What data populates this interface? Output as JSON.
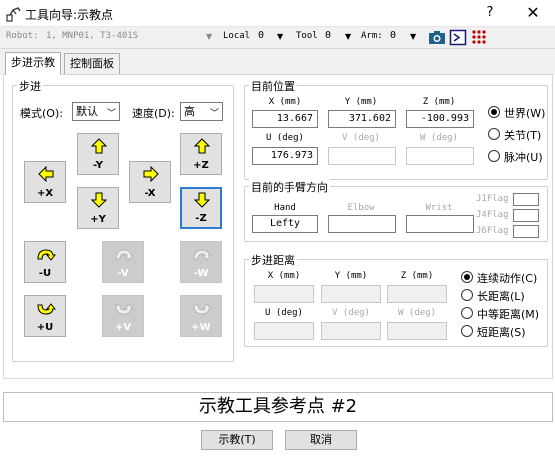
{
  "window": {
    "title": "工具向导:示教点",
    "help_label": "?",
    "close_label": "✕"
  },
  "toolbar": {
    "robot_label": "Robot:",
    "robot_value": "1, MNP01, T3-401S",
    "local_label": "Local",
    "local_value": "0",
    "tool_label": "Tool",
    "tool_value": "0",
    "arm_label": "Arm:",
    "arm_value": "0",
    "icons": [
      "camera-icon",
      "terminal-icon",
      "io-grid-icon"
    ]
  },
  "tabs": [
    {
      "label": "步进示教",
      "active": true
    },
    {
      "label": "控制面板",
      "active": false
    }
  ],
  "jog": {
    "group_title": "步进",
    "mode_label": "模式(O):",
    "mode_value": "默认",
    "speed_label": "速度(D):",
    "speed_value": "高",
    "buttons": {
      "minus_y": "-Y",
      "plus_z": "+Z",
      "plus_x": "+X",
      "minus_x": "-X",
      "plus_y": "+Y",
      "minus_z": "-Z",
      "minus_u": "-U",
      "minus_v": "-V",
      "minus_w": "-W",
      "plus_u": "+U",
      "plus_v": "+V",
      "plus_w": "+W"
    }
  },
  "current_position": {
    "group_title": "目前位置",
    "headers": [
      "X (mm)",
      "Y (mm)",
      "Z (mm)",
      "U (deg)",
      "V (deg)",
      "W (deg)"
    ],
    "x": "13.667",
    "y": "371.602",
    "z": "-100.993",
    "u": "176.973",
    "v": "",
    "w": "",
    "coord_options": [
      "世界(W)",
      "关节(T)",
      "脉冲(U)"
    ],
    "selected_coord": "世界(W)"
  },
  "arm_orientation": {
    "group_title": "目前的手臂方向",
    "headers": [
      "Hand",
      "Elbow",
      "Wrist"
    ],
    "hand": "Lefty",
    "flags": [
      "J1Flag",
      "J4Flag",
      "J6Flag"
    ]
  },
  "jog_distance": {
    "group_title": "步进距离",
    "headers": [
      "X (mm)",
      "Y (mm)",
      "Z (mm)",
      "U (deg)",
      "V (deg)",
      "W (deg)"
    ],
    "options": [
      "连续动作(C)",
      "长距离(L)",
      "中等距离(M)",
      "短距离(S)"
    ],
    "selected": "连续动作(C)"
  },
  "status_text": "示教工具参考点 #2",
  "footer": {
    "teach_label": "示教(T)",
    "cancel_label": "取消"
  }
}
